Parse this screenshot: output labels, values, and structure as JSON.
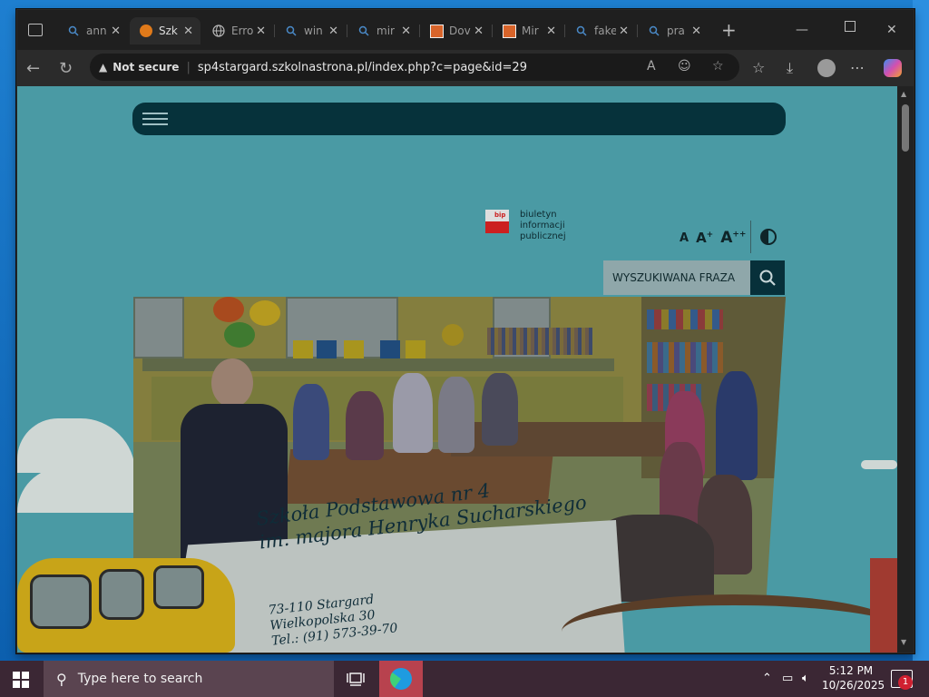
{
  "browser": {
    "tabs": [
      {
        "label": "ann",
        "icon": "search-icon",
        "active": false
      },
      {
        "label": "Szk",
        "icon": "site-favicon-icon",
        "active": true
      },
      {
        "label": "Erro",
        "icon": "globe-icon",
        "active": false
      },
      {
        "label": "win",
        "icon": "search-icon",
        "active": false
      },
      {
        "label": "mir",
        "icon": "search-icon",
        "active": false
      },
      {
        "label": "Dov",
        "icon": "store-icon",
        "active": false
      },
      {
        "label": "Mir",
        "icon": "store-icon",
        "active": false
      },
      {
        "label": "fake",
        "icon": "search-icon",
        "active": false
      },
      {
        "label": "pra",
        "icon": "search-icon",
        "active": false
      }
    ],
    "security_label": "Not secure",
    "url": "sp4stargard.szkolnastrona.pl/index.php?c=page&id=29"
  },
  "page": {
    "bip": {
      "logo_text": "bip",
      "line1": "biuletyn",
      "line2": "informacji publicznej"
    },
    "a11y": {
      "a_small": "A",
      "a_plus": "A",
      "a_plus_sup": "+",
      "a_plusplus": "A",
      "a_plusplus_sup": "++"
    },
    "search": {
      "placeholder": "WYSZUKIWANA FRAZA"
    },
    "school": {
      "name_line1": "Szkoła Podstawowa nr 4",
      "name_line2": "im. majora Henryka Sucharskiego",
      "address_line1": "73-110 Stargard",
      "address_line2": "Wielkopolska 30",
      "address_line3": "Tel.: (91) 573-39-70"
    }
  },
  "taskbar": {
    "search_placeholder": "Type here to search",
    "time": "5:12 PM",
    "date": "10/26/2025",
    "notification_count": "1"
  }
}
